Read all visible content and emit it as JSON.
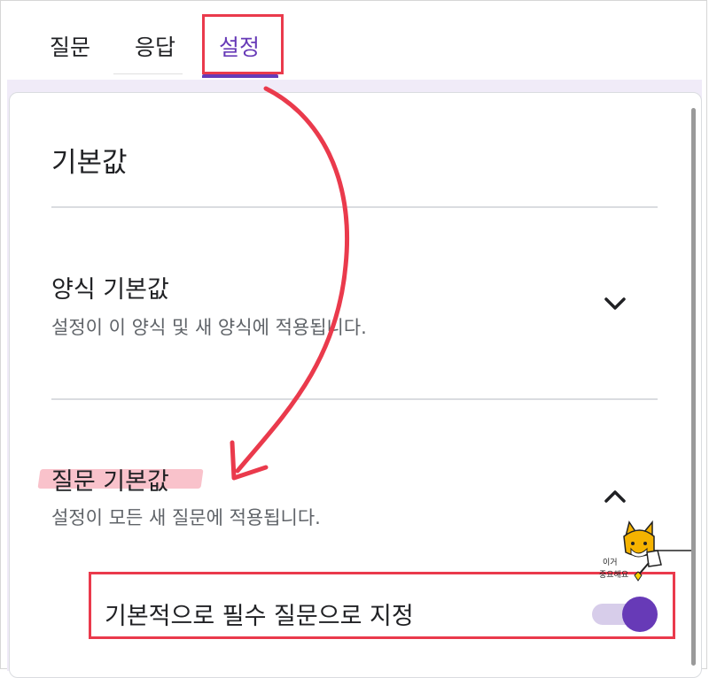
{
  "tabs": [
    {
      "label": "질문",
      "active": false
    },
    {
      "label": "응답",
      "active": false
    },
    {
      "label": "설정",
      "active": true
    }
  ],
  "accent_color": "#673ab7",
  "annotation_color": "#ea3a4c",
  "section": {
    "title": "기본값"
  },
  "rows": [
    {
      "title": "양식 기본값",
      "description": "설정이 이 양식 및 새 양식에 적용됩니다.",
      "expanded": false,
      "icon": "chevron-down-icon"
    },
    {
      "title": "질문 기본값",
      "description": "설정이 모든 새 질문에 적용됩니다.",
      "expanded": true,
      "icon": "chevron-up-icon"
    }
  ],
  "toggle": {
    "label": "기본적으로 필수 질문으로 지정",
    "checked": true
  },
  "sticker": {
    "line1": "이거",
    "line2": "중요해요",
    "icon": "fox-mascot-icon"
  }
}
